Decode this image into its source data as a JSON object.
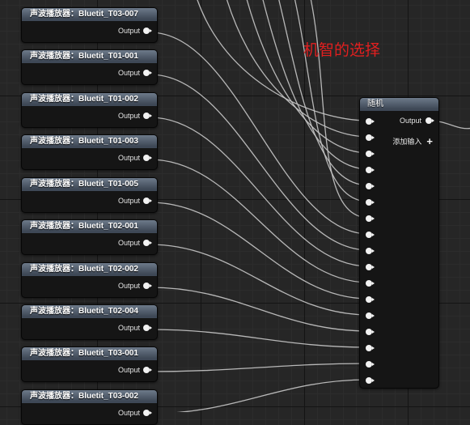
{
  "nodes": [
    {
      "title": "声波播放器：Bluetit_T03-007",
      "output": "Output"
    },
    {
      "title": "声波播放器：Bluetit_T01-001",
      "output": "Output"
    },
    {
      "title": "声波播放器：Bluetit_T01-002",
      "output": "Output"
    },
    {
      "title": "声波播放器：Bluetit_T01-003",
      "output": "Output"
    },
    {
      "title": "声波播放器：Bluetit_T01-005",
      "output": "Output"
    },
    {
      "title": "声波播放器：Bluetit_T02-001",
      "output": "Output"
    },
    {
      "title": "声波播放器：Bluetit_T02-002",
      "output": "Output"
    },
    {
      "title": "声波播放器：Bluetit_T02-004",
      "output": "Output"
    },
    {
      "title": "声波播放器：Bluetit_T03-001",
      "output": "Output"
    },
    {
      "title": "声波播放器：Bluetit_T03-002",
      "output": "Output"
    }
  ],
  "random_node": {
    "title": "随机",
    "output": "Output",
    "add_input": "添加输入",
    "input_count": 17
  },
  "annotation": "机智的选择",
  "colors": {
    "annotation": "#e11f1f",
    "pin": "#f2f2f2",
    "wire": "#c8c8c8",
    "header": "#5a6676"
  }
}
